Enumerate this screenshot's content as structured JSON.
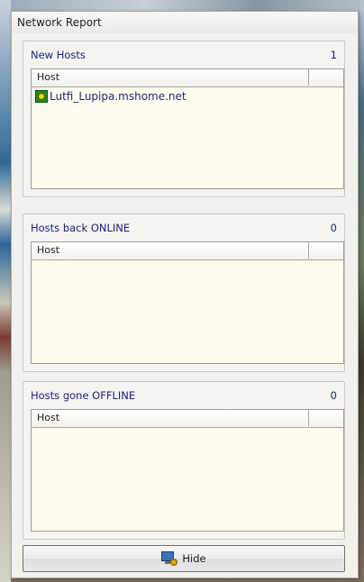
{
  "window": {
    "title": "Network Report"
  },
  "groups": [
    {
      "title": "New Hosts",
      "count": "1",
      "column_header": "Host",
      "rows": [
        "Lutfi_Lupipa.mshome.net"
      ]
    },
    {
      "title": "Hosts back ONLINE",
      "count": "0",
      "column_header": "Host",
      "rows": []
    },
    {
      "title": "Hosts gone OFFLINE",
      "count": "0",
      "column_header": "Host",
      "rows": []
    }
  ],
  "hide_button": {
    "label": "Hide",
    "icon": "monitor-icon"
  },
  "colors": {
    "group_title": "#1a237e",
    "list_background": "#fffbef",
    "window_background": "#f2f1ee"
  }
}
